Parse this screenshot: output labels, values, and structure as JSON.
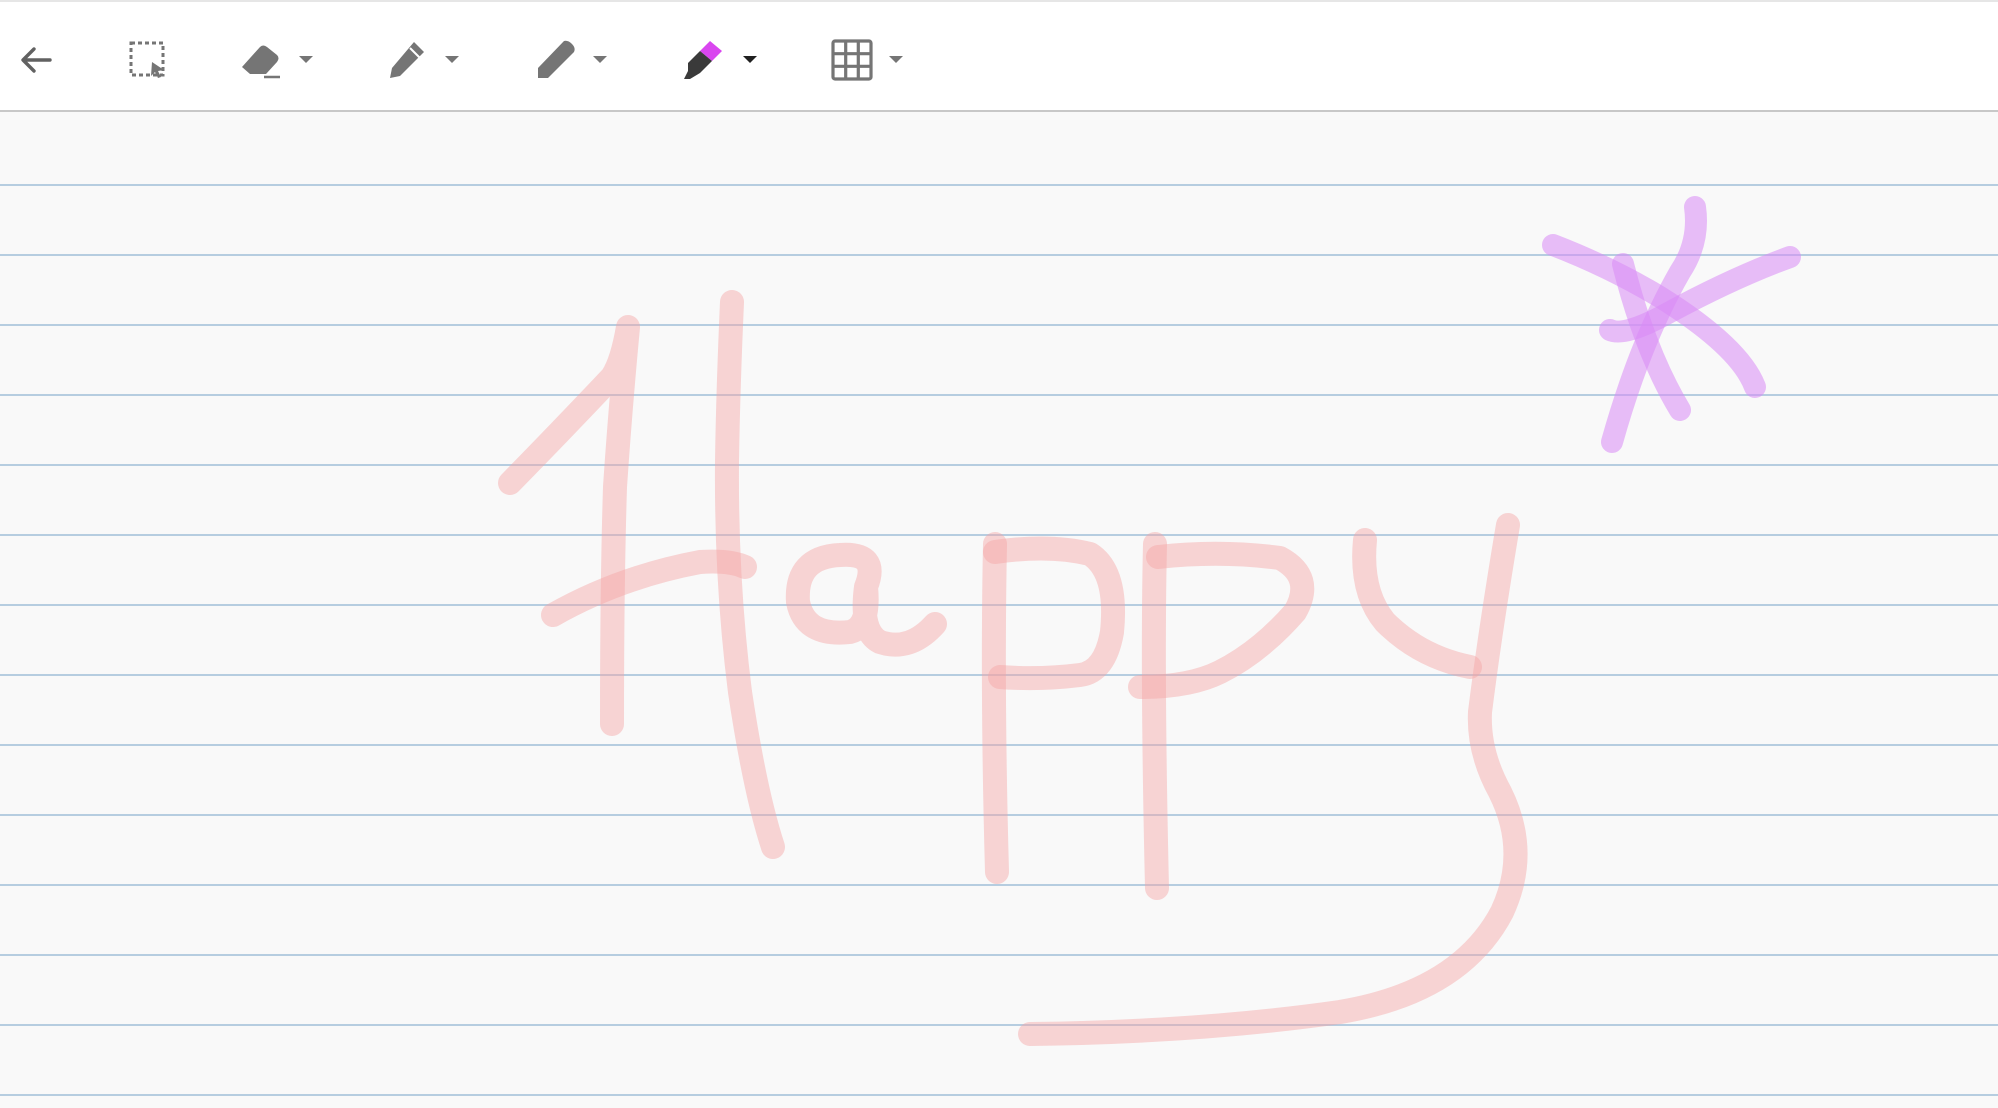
{
  "toolbar": {
    "tools": [
      {
        "id": "back",
        "icon": "back-arrow-icon",
        "has_dropdown": false
      },
      {
        "id": "lasso-select",
        "icon": "lasso-select-icon",
        "has_dropdown": false
      },
      {
        "id": "eraser",
        "icon": "eraser-icon",
        "has_dropdown": true
      },
      {
        "id": "ballpoint-pen",
        "icon": "ballpoint-pen-icon",
        "has_dropdown": true
      },
      {
        "id": "marker",
        "icon": "marker-icon",
        "has_dropdown": true
      },
      {
        "id": "highlighter",
        "icon": "highlighter-icon",
        "has_dropdown": true,
        "active": true,
        "color": "#d946ef"
      },
      {
        "id": "grid",
        "icon": "grid-icon",
        "has_dropdown": true
      }
    ]
  },
  "canvas": {
    "paper": "lined",
    "line_color": "#b6cde0",
    "background": "#f9f9f9",
    "strokes": [
      {
        "name": "handwritten-word-happy",
        "color": "#f4a3a3",
        "opacity": 0.45
      },
      {
        "name": "handwritten-asterisk",
        "color": "#d98af5",
        "opacity": 0.55
      }
    ]
  },
  "colors": {
    "icon_gray": "#757575",
    "icon_dark": "#5f5f5f",
    "active_tool_accent": "#d946ef"
  }
}
